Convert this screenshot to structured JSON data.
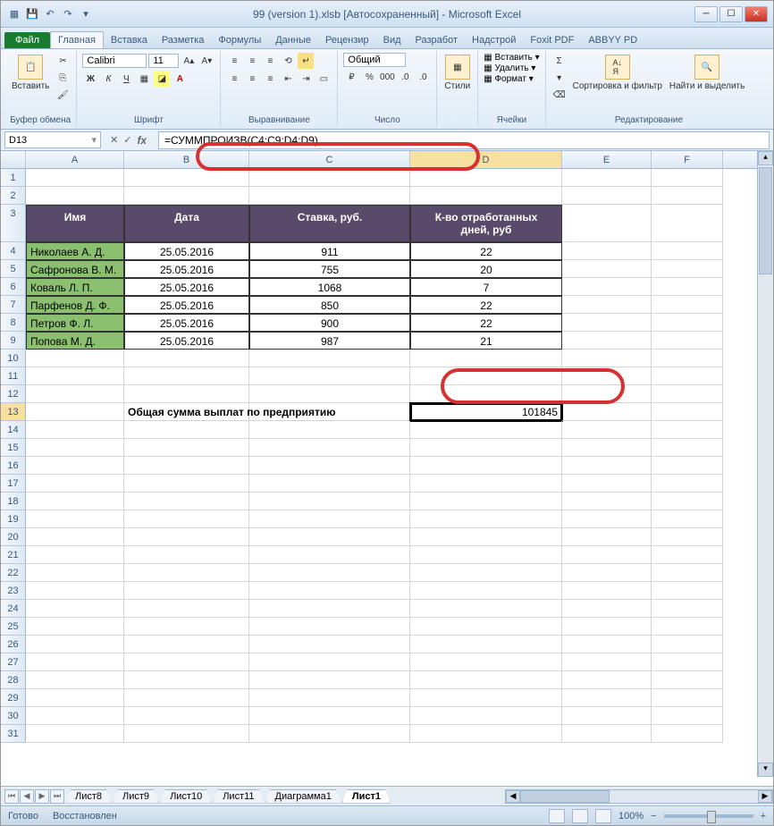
{
  "title": "99 (version 1).xlsb [Автосохраненный] - Microsoft Excel",
  "ribbon_tabs": {
    "file": "Файл",
    "items": [
      "Главная",
      "Вставка",
      "Разметка",
      "Формулы",
      "Данные",
      "Рецензир",
      "Вид",
      "Разработ",
      "Надстрой",
      "Foxit PDF",
      "ABBYY PD"
    ],
    "active": 0
  },
  "ribbon": {
    "clipboard": {
      "paste": "Вставить",
      "label": "Буфер обмена"
    },
    "font": {
      "name": "Calibri",
      "size": "11",
      "label": "Шрифт"
    },
    "align": {
      "label": "Выравнивание"
    },
    "number": {
      "format": "Общий",
      "label": "Число"
    },
    "styles": {
      "btn": "Стили"
    },
    "cells": {
      "insert": "Вставить",
      "delete": "Удалить",
      "format": "Формат",
      "label": "Ячейки"
    },
    "editing": {
      "sort": "Сортировка и фильтр",
      "find": "Найти и выделить",
      "label": "Редактирование"
    }
  },
  "name_box": "D13",
  "formula": "=СУММПРОИЗВ(C4:C9;D4:D9)",
  "columns": [
    "A",
    "B",
    "C",
    "D",
    "E",
    "F"
  ],
  "headers": {
    "name": "Имя",
    "date": "Дата",
    "rate": "Ставка, руб.",
    "days": "К-во отработанных дней, руб"
  },
  "rows": [
    {
      "name": "Николаев А. Д.",
      "date": "25.05.2016",
      "rate": "911",
      "days": "22"
    },
    {
      "name": "Сафронова В. М.",
      "date": "25.05.2016",
      "rate": "755",
      "days": "20"
    },
    {
      "name": "Коваль Л. П.",
      "date": "25.05.2016",
      "rate": "1068",
      "days": "7"
    },
    {
      "name": "Парфенов Д. Ф.",
      "date": "25.05.2016",
      "rate": "850",
      "days": "22"
    },
    {
      "name": "Петров Ф. Л.",
      "date": "25.05.2016",
      "rate": "900",
      "days": "22"
    },
    {
      "name": "Попова М. Д.",
      "date": "25.05.2016",
      "rate": "987",
      "days": "21"
    }
  ],
  "total_label": "Общая сумма выплат по предприятию",
  "total_value": "101845",
  "sheets": [
    "Лист8",
    "Лист9",
    "Лист10",
    "Лист11",
    "Диаграмма1",
    "Лист1"
  ],
  "active_sheet": 5,
  "status": {
    "ready": "Готово",
    "recovered": "Восстановлен",
    "zoom": "100%"
  },
  "chart_data": {
    "type": "table",
    "columns": [
      "Имя",
      "Дата",
      "Ставка, руб.",
      "К-во отработанных дней, руб"
    ],
    "rows": [
      [
        "Николаев А. Д.",
        "25.05.2016",
        911,
        22
      ],
      [
        "Сафронова В. М.",
        "25.05.2016",
        755,
        20
      ],
      [
        "Коваль Л. П.",
        "25.05.2016",
        1068,
        7
      ],
      [
        "Парфенов Д. Ф.",
        "25.05.2016",
        850,
        22
      ],
      [
        "Петров Ф. Л.",
        "25.05.2016",
        900,
        22
      ],
      [
        "Попова М. Д.",
        "25.05.2016",
        987,
        21
      ]
    ],
    "sumproduct_result": 101845
  }
}
